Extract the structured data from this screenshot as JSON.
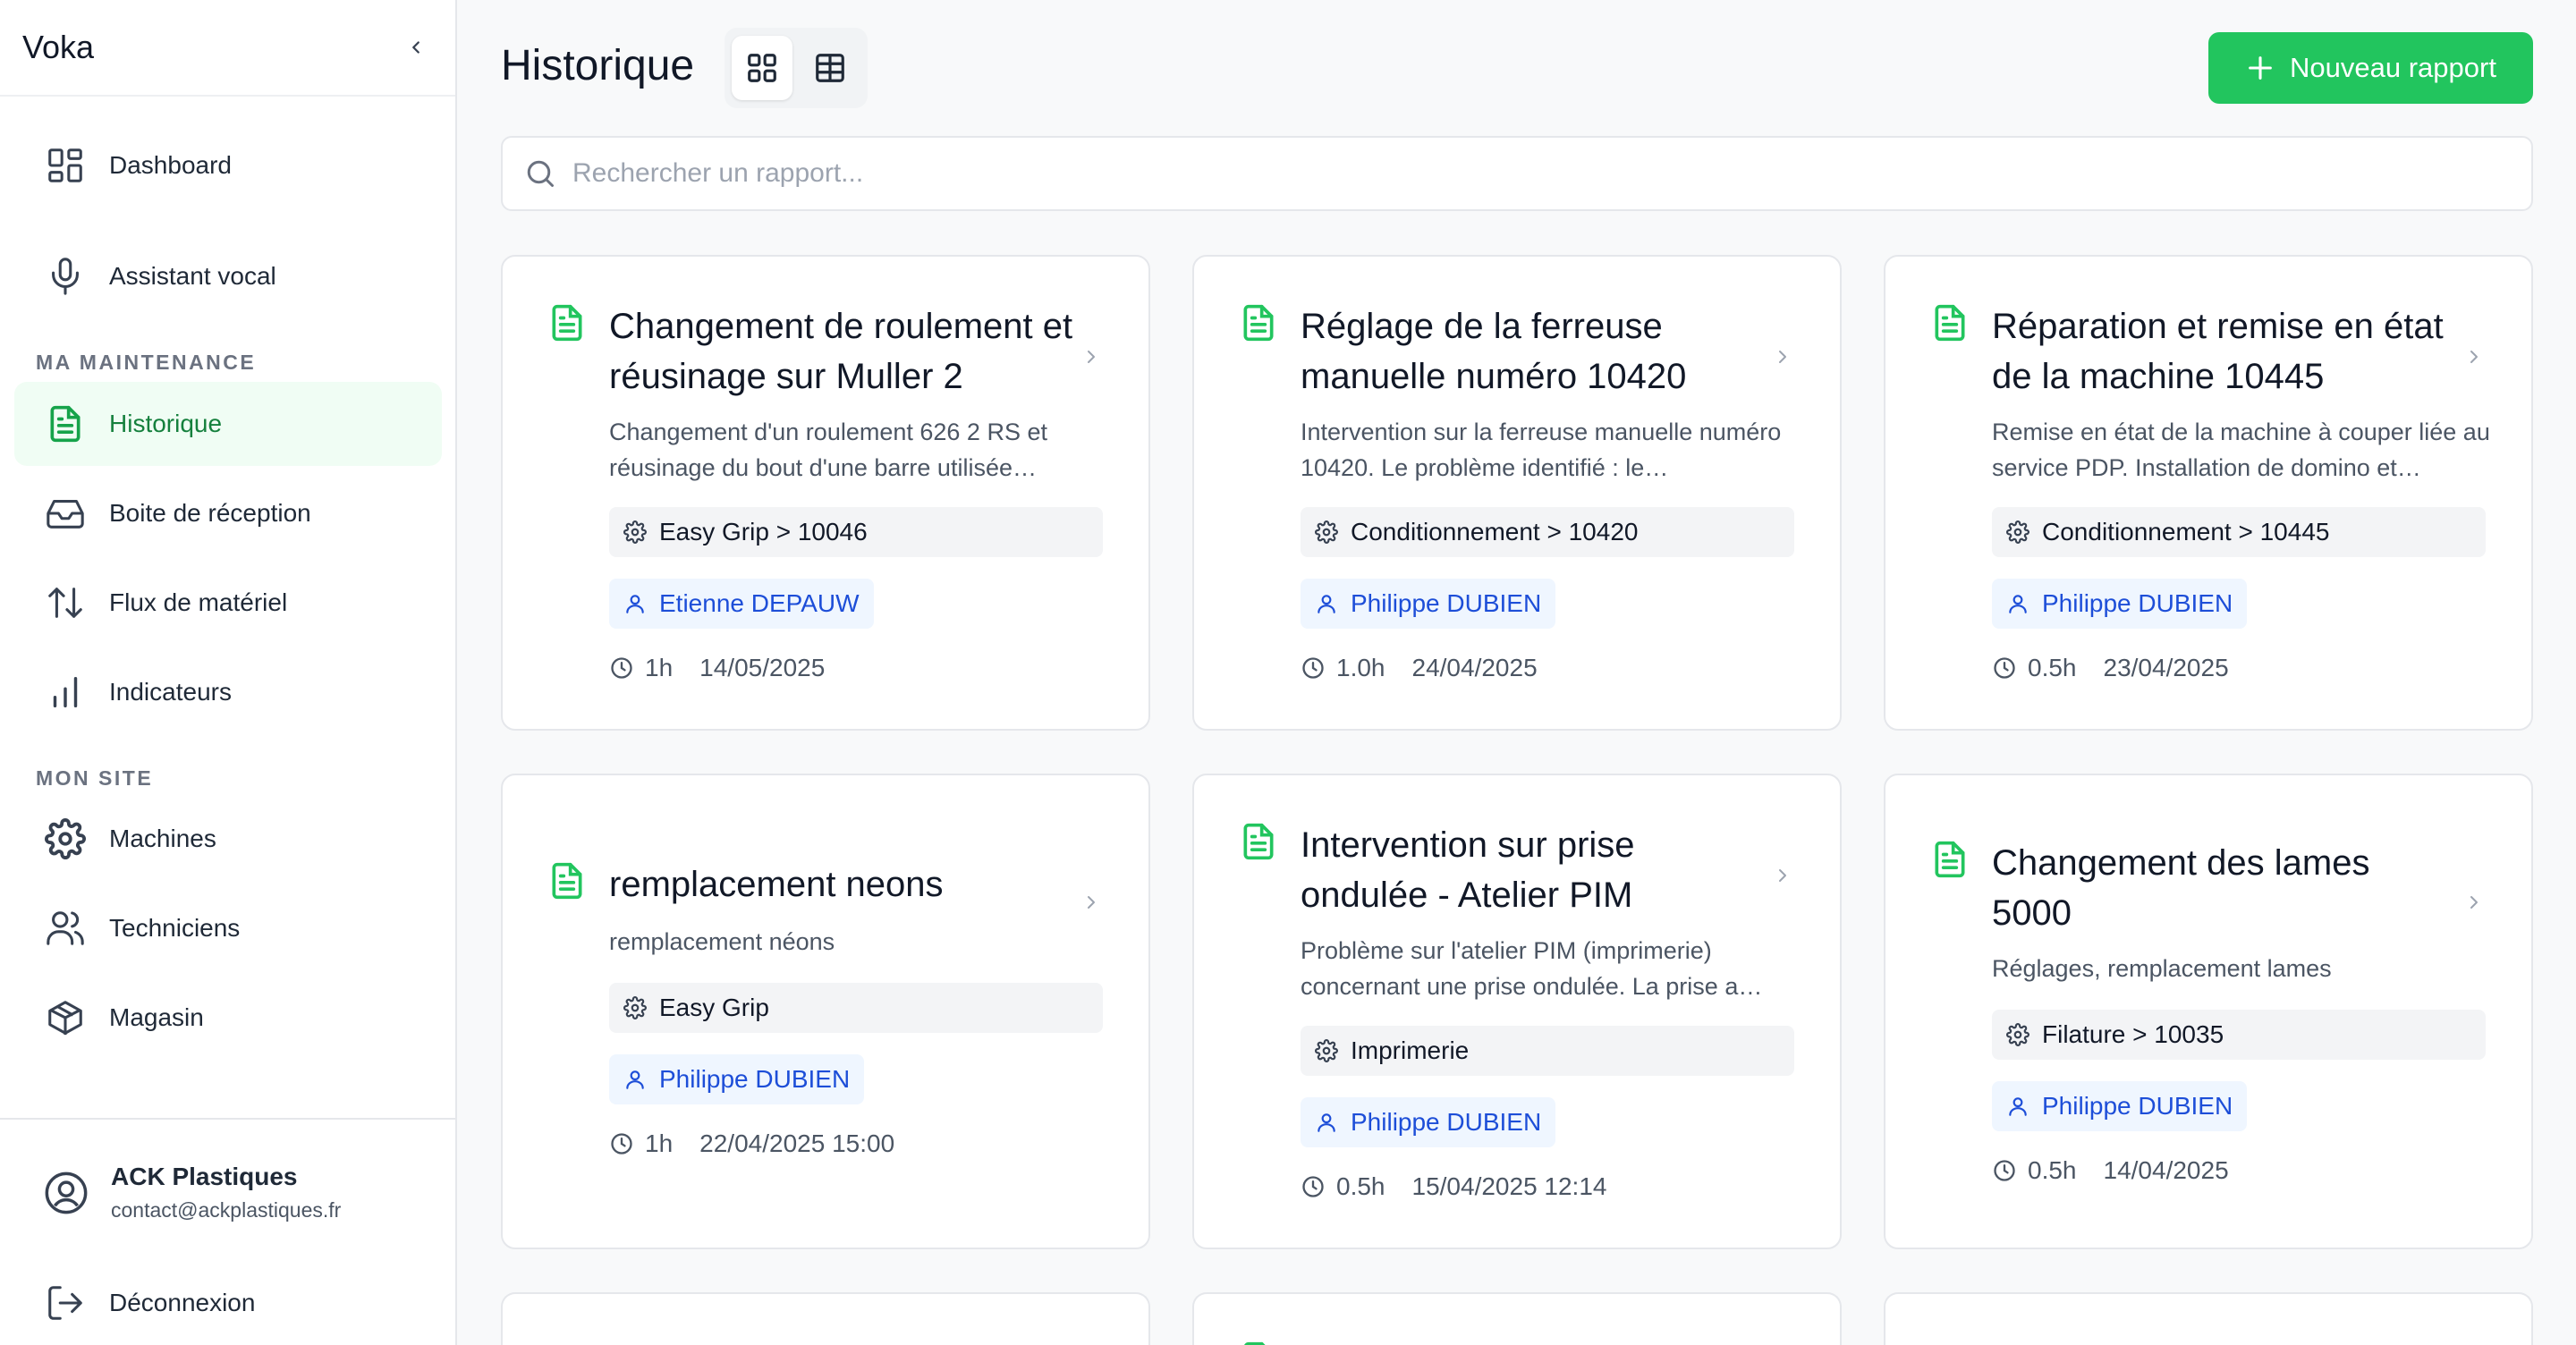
{
  "app": {
    "title": "Voka"
  },
  "sidebar": {
    "items": [
      {
        "label": "Dashboard"
      },
      {
        "label": "Assistant vocal"
      },
      {
        "label": "Historique"
      },
      {
        "label": "Boite de réception"
      },
      {
        "label": "Flux de matériel"
      },
      {
        "label": "Indicateurs"
      },
      {
        "label": "Machines"
      },
      {
        "label": "Techniciens"
      },
      {
        "label": "Magasin"
      }
    ],
    "sections": {
      "maintenance": "MA MAINTENANCE",
      "site": "MON SITE"
    },
    "org": {
      "name": "ACK Plastiques",
      "email": "contact@ackplastiques.fr"
    },
    "logout": "Déconnexion"
  },
  "header": {
    "title": "Historique",
    "new_button": "Nouveau rapport",
    "search_placeholder": "Rechercher un rapport..."
  },
  "colors": {
    "accent": "#22c55e",
    "tech_chip": "#1d4ed8",
    "active_nav_bg": "#f0fdf4"
  },
  "cards": [
    {
      "title": "Changement de roulement et réusinage sur Muller 2",
      "description": "Changement d'un roulement 626 2 RS et réusinage du bout d'une barre utilisée…",
      "machine": "Easy Grip > 10046",
      "technician": "Etienne DEPAUW",
      "duration": "1h",
      "date": "14/05/2025"
    },
    {
      "title": "Réglage de la ferreuse manuelle numéro 10420",
      "description": "Intervention sur la ferreuse manuelle numéro 10420. Le problème identifié : le…",
      "machine": "Conditionnement > 10420",
      "technician": "Philippe DUBIEN",
      "duration": "1.0h",
      "date": "24/04/2025"
    },
    {
      "title": "Réparation et remise en état de la machine 10445",
      "description": "Remise en état de la machine à couper liée au service PDP. Installation de domino et…",
      "machine": "Conditionnement > 10445",
      "technician": "Philippe DUBIEN",
      "duration": "0.5h",
      "date": "23/04/2025"
    },
    {
      "title": "remplacement neons",
      "description": "remplacement néons",
      "machine": "Easy Grip",
      "technician": "Philippe DUBIEN",
      "duration": "1h",
      "date": "22/04/2025 15:00"
    },
    {
      "title": "Intervention sur prise ondulée - Atelier PIM",
      "description": "Problème sur l'atelier PIM (imprimerie) concernant une prise ondulée. La prise a…",
      "machine": "Imprimerie",
      "technician": "Philippe DUBIEN",
      "duration": "0.5h",
      "date": "15/04/2025 12:14"
    },
    {
      "title": "Changement des lames 5000",
      "description": "Réglages, remplacement lames",
      "machine": "Filature > 10035",
      "technician": "Philippe DUBIEN",
      "duration": "0.5h",
      "date": "14/04/2025"
    }
  ]
}
